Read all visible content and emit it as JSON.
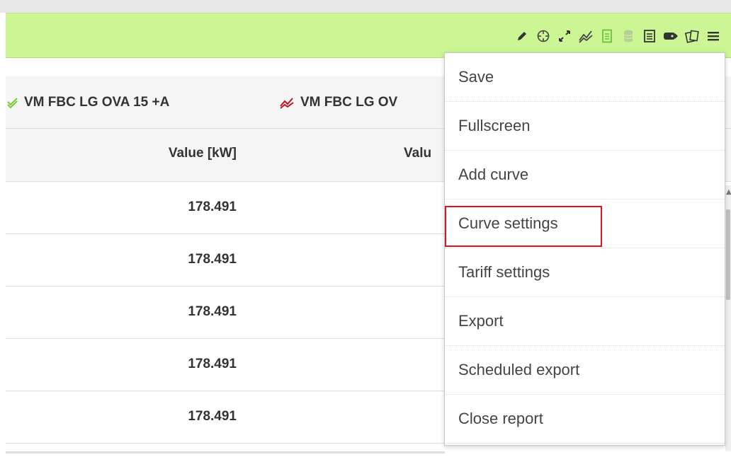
{
  "toolbar": {
    "icons": [
      "pencil-icon",
      "crosshair-icon",
      "expand-icon",
      "add-curve-icon",
      "document-icon",
      "database-icon",
      "list-icon",
      "tag-icon",
      "compare-icon",
      "hamburger-menu-icon"
    ],
    "background_color": "#ccf593"
  },
  "table": {
    "series": [
      {
        "label": "VM FBC LG OVA 15 +A",
        "icon": "check-curve-icon",
        "color": "#7cc83a"
      },
      {
        "label": "VM FBC LG OV",
        "icon": "curve-icon",
        "color": "#c0141e"
      }
    ],
    "columns": [
      "Value [kW]",
      "Valu"
    ],
    "rows": [
      {
        "value": "178.491"
      },
      {
        "value": "178.491"
      },
      {
        "value": "178.491"
      },
      {
        "value": "178.491"
      },
      {
        "value": "178.491"
      }
    ]
  },
  "menu": {
    "items": [
      "Save",
      "Fullscreen",
      "Add curve",
      "Curve settings",
      "Tariff settings",
      "Export",
      "Scheduled export",
      "Close report"
    ],
    "highlighted_item": "Curve settings",
    "highlight_color": "#e0141e"
  }
}
